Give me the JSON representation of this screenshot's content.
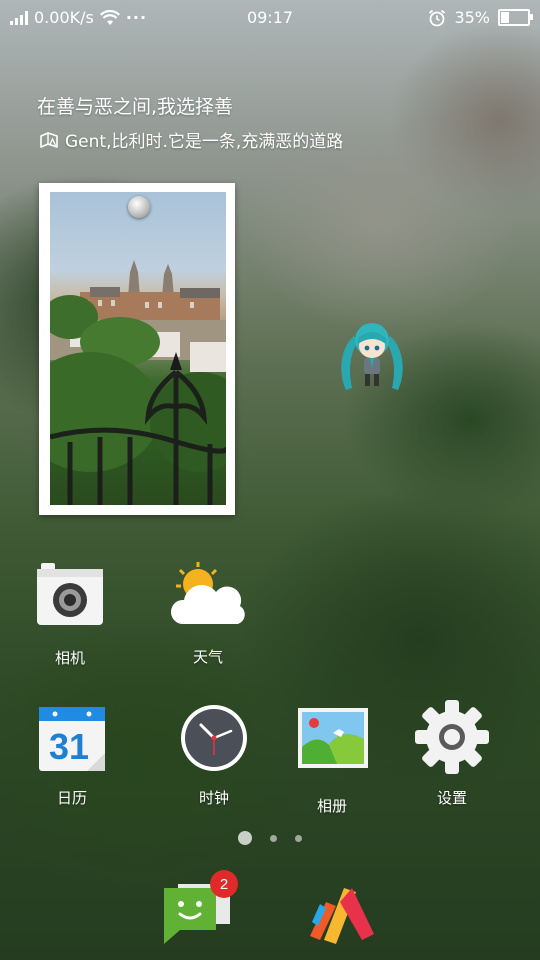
{
  "status_bar": {
    "network_speed": "0.00K/s",
    "overflow_indicator": "···",
    "time": "09:17",
    "battery_percent": "35%",
    "battery_level": 0.35,
    "icons": [
      "signal-icon",
      "wifi-icon",
      "alarm-icon",
      "battery-icon"
    ]
  },
  "quote_widget": {
    "line1": "在善与恶之间,我选择善",
    "line2": "Gent,比利时.它是一条,充满恶的道路",
    "icon": "map-icon"
  },
  "photo_widget": {
    "icon": "pushpin-icon"
  },
  "apps_row1": [
    {
      "label": "相机",
      "icon": "camera-icon"
    },
    {
      "label": "天气",
      "icon": "weather-icon"
    }
  ],
  "apps_row2": [
    {
      "label": "日历",
      "icon": "calendar-icon",
      "date": "31"
    },
    {
      "label": "时钟",
      "icon": "clock-icon"
    },
    {
      "label": "相册",
      "icon": "gallery-icon"
    },
    {
      "label": "设置",
      "icon": "settings-gear-icon"
    }
  ],
  "pager": {
    "pages": 3,
    "current": 1
  },
  "dock": [
    {
      "name": "messages",
      "icon": "messages-icon",
      "badge": "2"
    },
    {
      "name": "launcher",
      "icon": "launcher-icon"
    }
  ]
}
